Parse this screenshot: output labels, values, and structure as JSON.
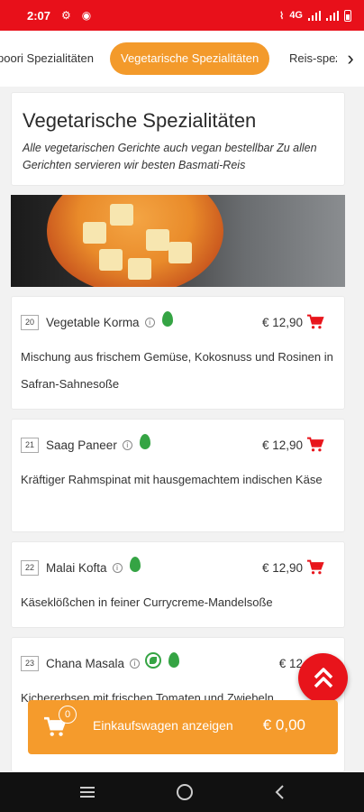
{
  "status_bar": {
    "time": "2:07",
    "network": "4G"
  },
  "tabs": [
    {
      "label": "poori Spezialitäten"
    },
    {
      "label": "Vegetarische Spezialitäten",
      "active": true
    },
    {
      "label": "Reis-spezi"
    }
  ],
  "section": {
    "title": "Vegetarische Spezialitäten",
    "subtitle": "Alle vegetarischen Gerichte auch vegan bestellbar Zu allen Gerichten servieren wir besten Basmati-Reis"
  },
  "items": [
    {
      "number": "20",
      "name": "Vegetable Korma",
      "price": "€ 12,90",
      "description": "Mischung aus frischem Gemüse, Kokosnuss und Rosinen in Safran-Sahnesoße"
    },
    {
      "number": "21",
      "name": "Saag Paneer",
      "price": "€ 12,90",
      "description": "Kräftiger Rahmspinat mit hausgemachtem indischen Käse"
    },
    {
      "number": "22",
      "name": "Malai Kofta",
      "price": "€ 12,90",
      "description": "Käseklößchen in feiner Currycreme-Mandelsoße"
    },
    {
      "number": "23",
      "name": "Chana Masala",
      "price": "€ 12",
      "description": "Kichererbsen mit frischen Tomaten und Zwiebeln"
    }
  ],
  "cart": {
    "count": "0",
    "label": "Einkaufswagen anzeigen",
    "total": "€ 0,00"
  },
  "colors": {
    "primary_red": "#e8101a",
    "accent_orange": "#f39a2b",
    "veg_green": "#35a444"
  }
}
